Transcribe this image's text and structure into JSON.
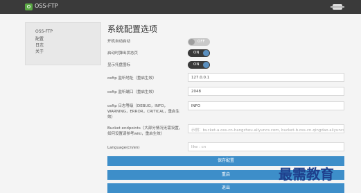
{
  "app": {
    "name": "OSS-FTP"
  },
  "sidebar": {
    "items": [
      {
        "label": "OSS-FTP"
      },
      {
        "label": "配置"
      },
      {
        "label": "日志"
      },
      {
        "label": "关于"
      }
    ]
  },
  "main": {
    "title": "系统配置选项",
    "toggles": [
      {
        "label": "开机自动启动",
        "state": "OFF"
      },
      {
        "label": "启动时弹出状态页",
        "state": "ON"
      },
      {
        "label": "显示托盘图标",
        "state": "ON"
      }
    ],
    "fields": [
      {
        "label": "osftp 监听地址（重启生效）",
        "value": "127.0.0.1"
      },
      {
        "label": "osftp 监听端口（重启生效）",
        "value": "2048"
      },
      {
        "label_lines": [
          "osftp 日志等级（DEBUG，INFO，",
          "WARNING，ERROR，CRITICAL，重启生",
          "效）"
        ],
        "value": "INFO"
      },
      {
        "label_lines": [
          "Bucket endpoints（大部分情况无需设置，",
          "如何设置请参考wiki，重启生效）"
        ],
        "placeholder": "示例：bucket-a.oss-cn-hangzhou.aliyuncs.com, bucket-b.oss-cn-qingdao.aliyuncs.com"
      },
      {
        "label": "Language(cn/en)",
        "placeholder": "like : cn"
      }
    ],
    "buttons": [
      {
        "label": "保存配置"
      },
      {
        "label": "重启"
      },
      {
        "label": "退出"
      }
    ]
  },
  "watermark": {
    "text": "最需教育"
  },
  "colors": {
    "topbar": "#3a3a3a",
    "button": "#3d8ec9",
    "toggle_on": "#3a3a3a",
    "toggle_off": "#c9c9c9"
  }
}
